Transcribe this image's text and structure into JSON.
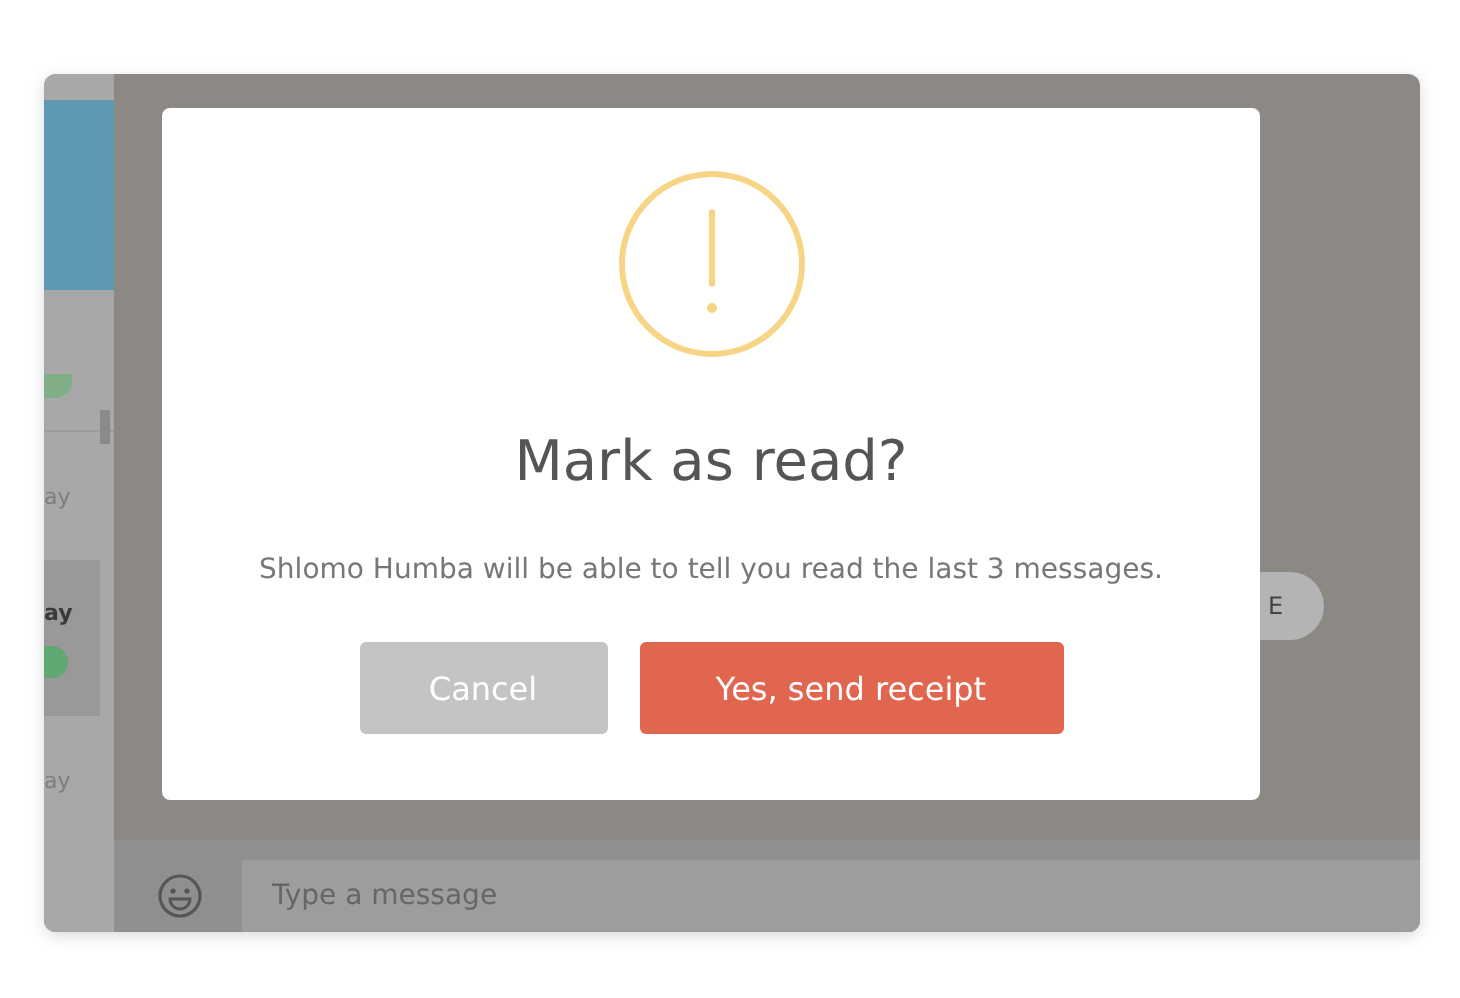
{
  "sidebar": {
    "items": [
      {
        "time": "ay",
        "selected": false
      },
      {
        "time": "ay",
        "selected": true
      },
      {
        "time": "ay",
        "selected": false
      }
    ]
  },
  "chat": {
    "action_pill": {
      "label": "E"
    },
    "composer": {
      "placeholder": "Type a message"
    }
  },
  "dialog": {
    "title": "Mark as read?",
    "message": "Shlomo Humba will be able to tell you read the last 3 messages.",
    "buttons": [
      {
        "label": "Cancel",
        "kind": "secondary"
      },
      {
        "label": "Yes, send receipt",
        "kind": "primary"
      }
    ]
  }
}
